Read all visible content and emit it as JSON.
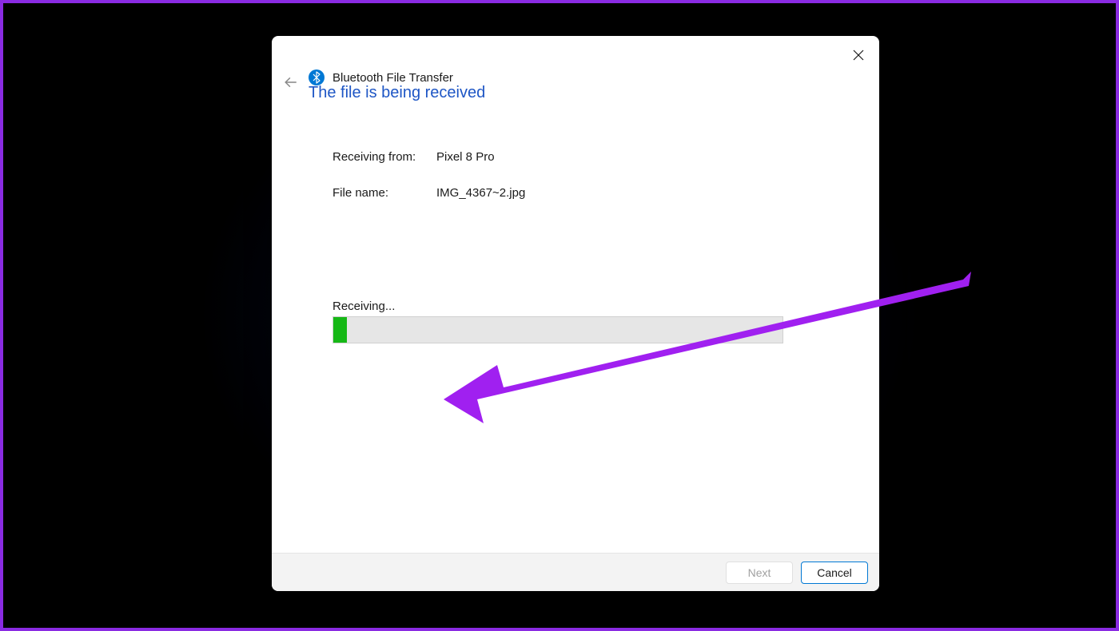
{
  "dialog": {
    "title": "Bluetooth File Transfer",
    "heading": "The file is being received",
    "info": {
      "receiving_from_label": "Receiving from:",
      "receiving_from_value": "Pixel 8 Pro",
      "file_name_label": "File name:",
      "file_name_value": "IMG_4367~2.jpg"
    },
    "progress": {
      "label": "Receiving...",
      "percent": 3
    },
    "buttons": {
      "next": "Next",
      "cancel": "Cancel"
    }
  },
  "colors": {
    "accent_blue": "#1e56c5",
    "progress_green": "#16b816",
    "annotation_purple": "#a020f0"
  }
}
